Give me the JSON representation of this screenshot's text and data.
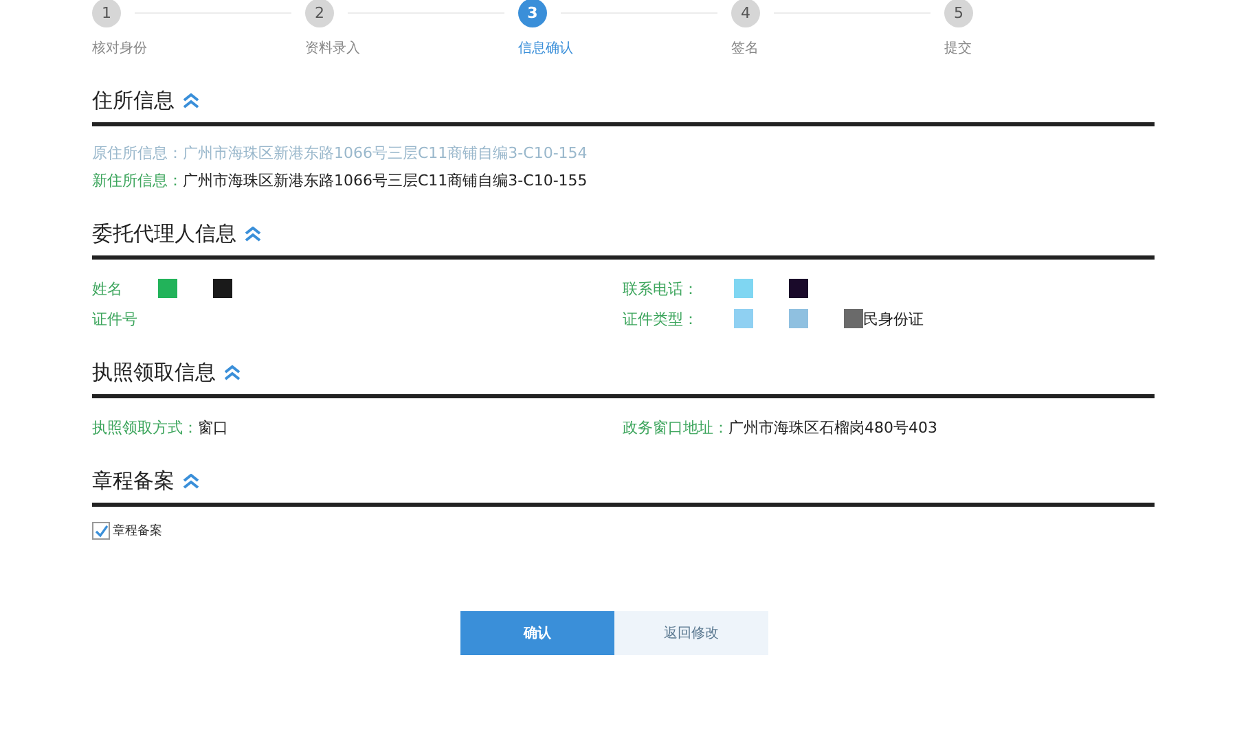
{
  "steps": [
    {
      "number": "1",
      "label": "核对身份",
      "selected": false
    },
    {
      "number": "2",
      "label": "资料录入",
      "selected": false
    },
    {
      "number": "3",
      "label": "信息确认",
      "selected": true
    },
    {
      "number": "4",
      "label": "签名",
      "selected": false
    },
    {
      "number": "5",
      "label": "提交",
      "selected": false
    }
  ],
  "sections": [
    {
      "title": "住所信息",
      "kind": "lines",
      "fields": [
        {
          "label": "原住所信息：",
          "value": "广州市海珠区新港东路1066号三层C11商铺自编3-C10-154",
          "disabled": true
        },
        {
          "label": "新住所信息：",
          "value": "广州市海珠区新港东路1066号三层C11商铺自编3-C10-155",
          "disabled": false
        }
      ]
    },
    {
      "title": "委托代理人信息",
      "kind": "grid",
      "fields": [
        {
          "label": "姓名",
          "masks": [
            {
              "color": "#22b35a"
            },
            {
              "color": "#1a1a1a"
            }
          ]
        },
        {
          "label": "联系电话：",
          "masks": [
            {
              "color": "#7fd6f2"
            },
            {
              "color": "#1a0a2a"
            }
          ]
        },
        {
          "label": "证件号"
        },
        {
          "label": "证件类型：",
          "value": "民身份证",
          "masks": [
            {
              "color": "#8fd0f2"
            },
            {
              "color": "#8fc0e0"
            },
            {
              "color": "#6a6a6a"
            }
          ]
        }
      ]
    },
    {
      "title": "执照领取信息",
      "kind": "grid",
      "fields": [
        {
          "label": "执照领取方式：",
          "value": "窗口"
        },
        {
          "label": "政务窗口地址：",
          "value": "广州市海珠区石榴岗480号403"
        }
      ]
    },
    {
      "title": "章程备案",
      "kind": "checkbox",
      "checkbox": {
        "label": "章程备案",
        "checked": true
      }
    }
  ],
  "buttons": [
    {
      "label": "确认",
      "kind": "primary"
    },
    {
      "label": "返回修改",
      "kind": "secondary"
    }
  ]
}
